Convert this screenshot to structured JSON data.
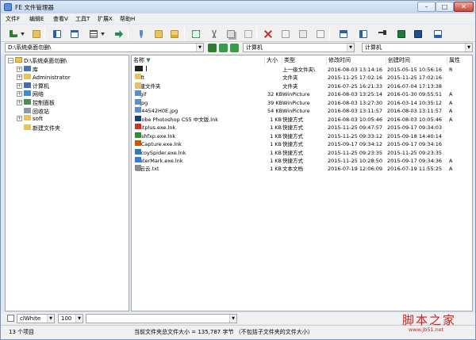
{
  "window": {
    "title": "FE 文件管理器"
  },
  "menu": [
    "文件F",
    "编辑E",
    "查看V",
    "工具T",
    "扩展X",
    "帮助H"
  ],
  "address": {
    "path": "D:\\系统桌面勿删\\",
    "left_location": "计算机",
    "right_location": "计算机"
  },
  "tree": {
    "root": "D:\\系统桌面勿删\\",
    "items": [
      {
        "label": "库",
        "icon": "library-icon",
        "expander": "+"
      },
      {
        "label": "Administrator",
        "icon": "user-folder-icon",
        "expander": "+"
      },
      {
        "label": "计算机",
        "icon": "computer-icon",
        "expander": "+"
      },
      {
        "label": "网络",
        "icon": "network-icon",
        "expander": "+"
      },
      {
        "label": "控制面板",
        "icon": "control-panel-icon",
        "expander": "+"
      },
      {
        "label": "回收站",
        "icon": "recycle-bin-icon",
        "expander": ""
      },
      {
        "label": "soft",
        "icon": "folder-icon",
        "expander": "+"
      },
      {
        "label": "新建文件夹",
        "icon": "folder-icon",
        "expander": ""
      }
    ]
  },
  "list": {
    "columns": {
      "name": "名称",
      "size": "大小",
      "type": "类型",
      "modified": "修改时间",
      "created": "创建时间",
      "attr": "属性"
    },
    "rows": [
      {
        "name": "..",
        "size": "",
        "type": "上一级文件夹\\",
        "modified": "2016-08-03 13:14:16",
        "created": "2015-05-15 10:56:16",
        "attr": "R",
        "icon": "parent-folder-icon",
        "color": "#222222"
      },
      {
        "name": "soft",
        "size": "",
        "type": "文件夹",
        "modified": "2015-11-25 17:02:16",
        "created": "2015-11-25 17:02:16",
        "attr": "",
        "icon": "folder-icon",
        "color": "#e8c25a"
      },
      {
        "name": "新建文件夹",
        "size": "",
        "type": "文件夹",
        "modified": "2016-07-25 16:21:33",
        "created": "2016-07-04 17:13:38",
        "attr": "",
        "icon": "folder-icon",
        "color": "#e8c25a"
      },
      {
        "name": "1.gif",
        "size": "32 KB",
        "type": "WinPicture",
        "modified": "2016-08-03 13:25:14",
        "created": "2016-01-30 09:55:51",
        "attr": "A",
        "icon": "image-icon",
        "color": "#5a8fc8"
      },
      {
        "name": "1.jpg",
        "size": "39 KB",
        "type": "WinPicture",
        "modified": "2016-08-03 13:27:30",
        "created": "2016-03-14 10:35:12",
        "attr": "A",
        "icon": "image-icon",
        "color": "#5a8fc8"
      },
      {
        "name": "1044542H0E.jpg",
        "size": "54 KB",
        "type": "WinPicture",
        "modified": "2016-08-03 13:11:57",
        "created": "2016-08-03 13:11:57",
        "attr": "A",
        "icon": "image-icon",
        "color": "#5a8fc8"
      },
      {
        "name": "Adobe Photoshop CS5 中文版.lnk",
        "size": "1 KB",
        "type": "快捷方式",
        "modified": "2016-08-03 10:05:46",
        "created": "2016-08-03 10:05:46",
        "attr": "A",
        "icon": "photoshop-icon",
        "color": "#1f3f7a"
      },
      {
        "name": "editplus.exe.lnk",
        "size": "1 KB",
        "type": "快捷方式",
        "modified": "2015-11-25 09:47:57",
        "created": "2015-09-17 09:34:03",
        "attr": "",
        "icon": "editplus-icon",
        "color": "#c0392b"
      },
      {
        "name": "flashfxp.exe.lnk",
        "size": "1 KB",
        "type": "快捷方式",
        "modified": "2015-11-25 09:33:12",
        "created": "2015-09-18 14:40:14",
        "attr": "",
        "icon": "flashfxp-icon",
        "color": "#2e8b3a"
      },
      {
        "name": "FSCapture.exe.lnk",
        "size": "1 KB",
        "type": "快捷方式",
        "modified": "2015-09-17 09:34:12",
        "created": "2015-09-17 09:34:16",
        "attr": "",
        "icon": "fscapture-icon",
        "color": "#d35400"
      },
      {
        "name": "LocoySpider.exe.lnk",
        "size": "1 KB",
        "type": "快捷方式",
        "modified": "2015-11-25 09:23:35",
        "created": "2015-11-25 09:23:35",
        "attr": "",
        "icon": "spider-icon",
        "color": "#2980b9"
      },
      {
        "name": "WaterMark.exe.lnk",
        "size": "1 KB",
        "type": "快捷方式",
        "modified": "2015-11-25 10:28:50",
        "created": "2015-09-17 09:34:36",
        "attr": "A",
        "icon": "watermark-icon",
        "color": "#3a7bd5"
      },
      {
        "name": "裁云云.txt",
        "size": "1 KB",
        "type": "文本文档",
        "modified": "2016-07-19 12:06:09",
        "created": "2016-07-19 11:55:25",
        "attr": "A",
        "icon": "text-file-icon",
        "color": "#8a8a8a"
      }
    ]
  },
  "bottom": {
    "color_value": "clWhite",
    "zoom_value": "100"
  },
  "status": {
    "count": "13 个项目",
    "summary": "当前文件夹总文件大小 = 135,787 字节 （不包括子文件夹的文件大小）"
  },
  "watermark": {
    "main": "脚本之家",
    "sub": "www.jb51.net"
  },
  "toolbar_icons": [
    "view-mode-icon",
    "dropdown-arrow-icon",
    "up-folder-icon",
    "panel-left-icon",
    "panel-right-icon",
    "details-view-icon",
    "dropdown-arrow-icon",
    "go-icon",
    "brush-icon",
    "folder-open-icon",
    "new-folder-icon",
    "select-all-icon",
    "cut-icon",
    "copy-icon",
    "paste-icon",
    "delete-icon",
    "rename-icon",
    "properties-icon",
    "checklist-icon",
    "grid-view-icon",
    "list-view-icon",
    "search-icon",
    "image-view-icon",
    "play-icon",
    "options-icon"
  ],
  "colors": {
    "accent": "#2d5ea8",
    "list_header_arrow": "#2a8a55",
    "close_button": "#c8483a",
    "watermark": "#cf1f1f"
  }
}
